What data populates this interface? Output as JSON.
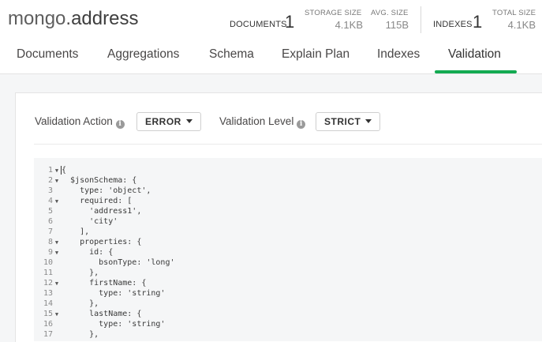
{
  "header": {
    "database": "mongo",
    "dot": ".",
    "collection": "address",
    "documents_label": "DOCUMENTS",
    "documents_count": "1",
    "storage_size_label": "STORAGE SIZE",
    "storage_size_value": "4.1KB",
    "avg_size_label": "AVG. SIZE",
    "avg_size_value": "115B",
    "indexes_label": "INDEXES",
    "indexes_count": "1",
    "total_size_label": "TOTAL SIZE",
    "total_size_value": "4.1KB"
  },
  "tabs": [
    {
      "label": "Documents"
    },
    {
      "label": "Aggregations"
    },
    {
      "label": "Schema"
    },
    {
      "label": "Explain Plan"
    },
    {
      "label": "Indexes"
    },
    {
      "label": "Validation",
      "active": true
    }
  ],
  "validation": {
    "action_label": "Validation Action",
    "action_value": "ERROR",
    "level_label": "Validation Level",
    "level_value": "STRICT",
    "info_glyph": "i"
  },
  "colors": {
    "accent": "#13aa52",
    "background": "#f5f6f7"
  },
  "editor": {
    "lines": [
      {
        "n": "1",
        "fold": "▼",
        "text": "{"
      },
      {
        "n": "2",
        "fold": "▼",
        "text": "  $jsonSchema: {"
      },
      {
        "n": "3",
        "fold": "",
        "text": "    type: 'object',"
      },
      {
        "n": "4",
        "fold": "▼",
        "text": "    required: ["
      },
      {
        "n": "5",
        "fold": "",
        "text": "      'address1',"
      },
      {
        "n": "6",
        "fold": "",
        "text": "      'city'"
      },
      {
        "n": "7",
        "fold": "",
        "text": "    ],"
      },
      {
        "n": "8",
        "fold": "▼",
        "text": "    properties: {"
      },
      {
        "n": "9",
        "fold": "▼",
        "text": "      id: {"
      },
      {
        "n": "10",
        "fold": "",
        "text": "        bsonType: 'long'"
      },
      {
        "n": "11",
        "fold": "",
        "text": "      },"
      },
      {
        "n": "12",
        "fold": "▼",
        "text": "      firstName: {"
      },
      {
        "n": "13",
        "fold": "",
        "text": "        type: 'string'"
      },
      {
        "n": "14",
        "fold": "",
        "text": "      },"
      },
      {
        "n": "15",
        "fold": "▼",
        "text": "      lastName: {"
      },
      {
        "n": "16",
        "fold": "",
        "text": "        type: 'string'"
      },
      {
        "n": "17",
        "fold": "",
        "text": "      },"
      }
    ]
  }
}
